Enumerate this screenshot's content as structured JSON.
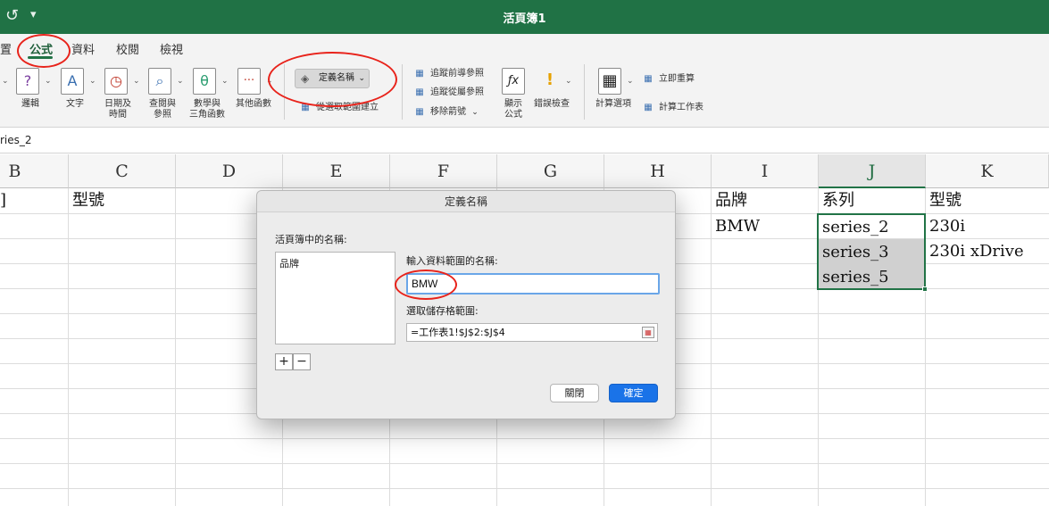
{
  "window": {
    "title": "活頁簿1",
    "undo_glyph": "↺",
    "qa_glyph": "▾"
  },
  "ribbon": {
    "tabs": [
      "置",
      "公式",
      "資料",
      "校閱",
      "檢視"
    ],
    "buttons": {
      "logic": "邏輯",
      "text": "文字",
      "datetime_1": "日期及",
      "datetime_2": "時間",
      "lookup_1": "查閱與",
      "lookup_2": "參照",
      "math_1": "數學與",
      "math_2": "三角函數",
      "other": "其他函數",
      "define_name": "定義名稱",
      "create_from_selection": "從選取範圍建立",
      "trace_precedents": "追蹤前導參照",
      "trace_dependents": "追蹤從屬參照",
      "remove_arrows": "移除箭號",
      "show_formulas_1": "顯示",
      "show_formulas_2": "公式",
      "error_checking": "錯誤檢查",
      "calc_options": "計算選項",
      "calc_now": "立即重算",
      "calc_sheet": "計算工作表"
    },
    "icons": {
      "logic": "?",
      "text": "A",
      "datetime": "◷",
      "lookup": "⌕",
      "math": "θ",
      "other": "···",
      "fx": "ƒx",
      "warn": "!",
      "tag": "◈",
      "chevron": "⌄",
      "grid": "▦"
    }
  },
  "formula_bar": {
    "name_box": "ries_2"
  },
  "sheet": {
    "columns": [
      "B",
      "C",
      "D",
      "E",
      "F",
      "G",
      "H",
      "I",
      "J",
      "K"
    ],
    "partial_first_col_cell": "]",
    "cells": {
      "C1": "型號",
      "I1": "品牌",
      "J1": "系列",
      "K1": "型號",
      "I2": "BMW",
      "J2": "series_2",
      "K2": "230i",
      "J3": "series_3",
      "K3": "230i xDrive",
      "J4": "series_5"
    }
  },
  "dialog": {
    "title": "定義名稱",
    "names_label": "活頁簿中的名稱:",
    "names": [
      "品牌"
    ],
    "name_input_label": "輸入資料範圍的名稱:",
    "name_input_value": "BMW",
    "range_label": "選取儲存格範圍:",
    "range_value": "=工作表1!$J$2:$J$4",
    "add": "+",
    "remove": "−",
    "close": "關閉",
    "ok": "確定"
  }
}
